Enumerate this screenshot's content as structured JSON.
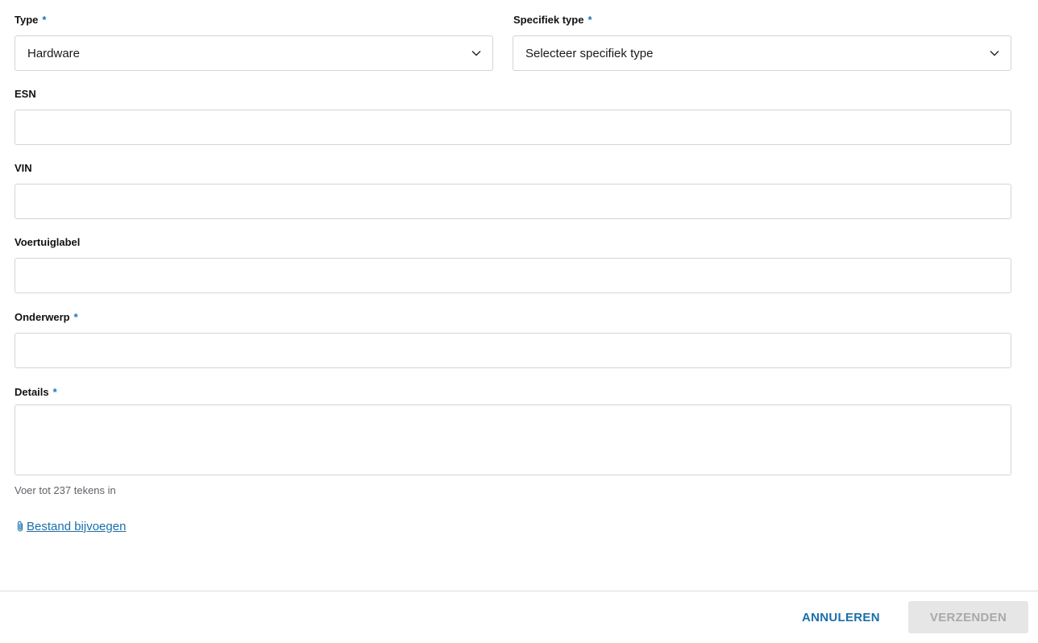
{
  "form": {
    "type": {
      "label": "Type",
      "required_marker": "*",
      "value": "Hardware"
    },
    "specific_type": {
      "label": "Specifiek type",
      "required_marker": "*",
      "placeholder": "Selecteer specifiek type"
    },
    "esn": {
      "label": "ESN",
      "value": ""
    },
    "vin": {
      "label": "VIN",
      "value": ""
    },
    "vehicle_label": {
      "label": "Voertuiglabel",
      "value": ""
    },
    "subject": {
      "label": "Onderwerp",
      "required_marker": "*",
      "value": ""
    },
    "details": {
      "label": "Details",
      "required_marker": "*",
      "value": "",
      "hint": "Voer tot 237 tekens in"
    },
    "attach": {
      "icon": "paperclip-icon",
      "label": "Bestand bijvoegen"
    }
  },
  "footer": {
    "cancel_label": "ANNULEREN",
    "submit_label": "VERZENDEN",
    "submit_enabled": false
  },
  "colors": {
    "accent": "#1a6fa8",
    "required": "#1a73b8",
    "border": "#d2d4d6",
    "disabled_bg": "#e6e6e6",
    "disabled_text": "#a9a9a9"
  }
}
